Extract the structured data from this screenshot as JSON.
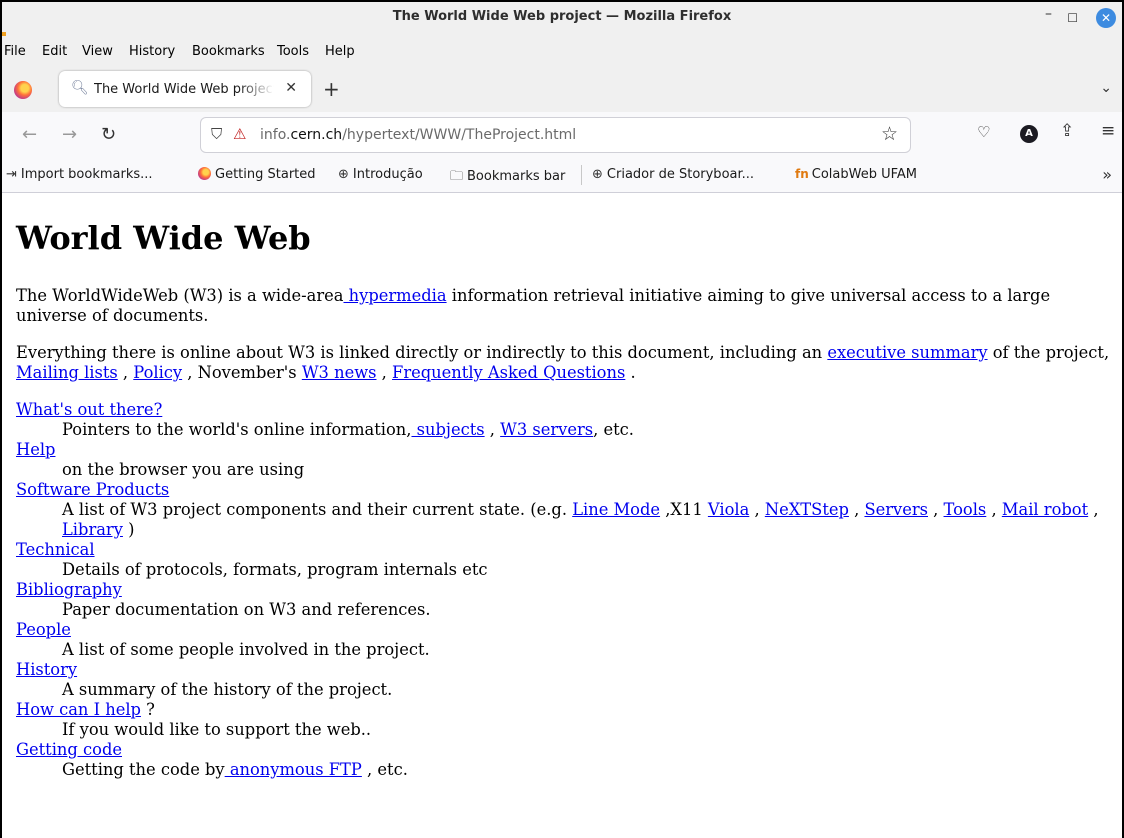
{
  "window": {
    "title": "The World Wide Web project — Mozilla Firefox"
  },
  "menu": [
    "File",
    "Edit",
    "View",
    "History",
    "Bookmarks",
    "Tools",
    "Help"
  ],
  "tab": {
    "title": "The World Wide Web project"
  },
  "url": {
    "domain_prefix": "info.",
    "domain": "cern.ch",
    "path": "/hypertext/WWW/TheProject.html"
  },
  "bookmarks": [
    "Import bookmarks...",
    "Getting Started",
    "Introdução",
    "Bookmarks bar",
    "Criador de Storyboar...",
    "ColabWeb UFAM"
  ],
  "page": {
    "heading": "World Wide Web",
    "p1": {
      "t1": "The WorldWideWeb (W3) is a wide-area",
      "link_hypermedia": " hypermedia",
      "t2": " information retrieval initiative aiming to give universal access to a large universe of documents."
    },
    "p2": {
      "t1": "Everything there is online about W3 is linked directly or indirectly to this document, including an ",
      "link_summary": "executive summary",
      "t2": " of the project, ",
      "link_mailing": "Mailing lists",
      "t3": " , ",
      "link_policy": "Policy",
      "t4": " , November's ",
      "link_news": "W3 news",
      "t5": " , ",
      "link_faq": "Frequently Asked Questions",
      "t6": " ."
    },
    "items": {
      "whats_out": {
        "term": "What's out there?",
        "d1": "Pointers to the world's online information,",
        "link1": " subjects",
        "d2": " , ",
        "link2": "W3 servers",
        "d3": ", etc."
      },
      "help": {
        "term": "Help",
        "desc": "on the browser you are using"
      },
      "software": {
        "term": "Software Products",
        "d1": "A list of W3 project components and their current state. (e.g. ",
        "link_line_mode": "Line Mode",
        "d2": " ,X11 ",
        "link_viola": "Viola",
        "d3": " , ",
        "link_nextstep": "NeXTStep",
        "d4": " , ",
        "link_servers": "Servers",
        "d5": " , ",
        "link_tools": "Tools",
        "d6": " , ",
        "link_mail_robot": "Mail robot",
        "d7": " ,",
        "link_library": " Library",
        "d8": " )"
      },
      "technical": {
        "term": "Technical",
        "desc": "Details of protocols, formats, program internals etc"
      },
      "bibliography": {
        "term": "Bibliography",
        "desc": "Paper documentation on W3 and references."
      },
      "people": {
        "term": "People",
        "desc": "A list of some people involved in the project."
      },
      "history": {
        "term": "History",
        "desc": "A summary of the history of the project."
      },
      "howcan": {
        "term": "How can I help",
        "after": " ?",
        "desc": "If you would like to support the web.."
      },
      "getting": {
        "term": "Getting code",
        "d1": "Getting the code by",
        "link": " anonymous FTP",
        "d2": " , etc."
      }
    }
  }
}
